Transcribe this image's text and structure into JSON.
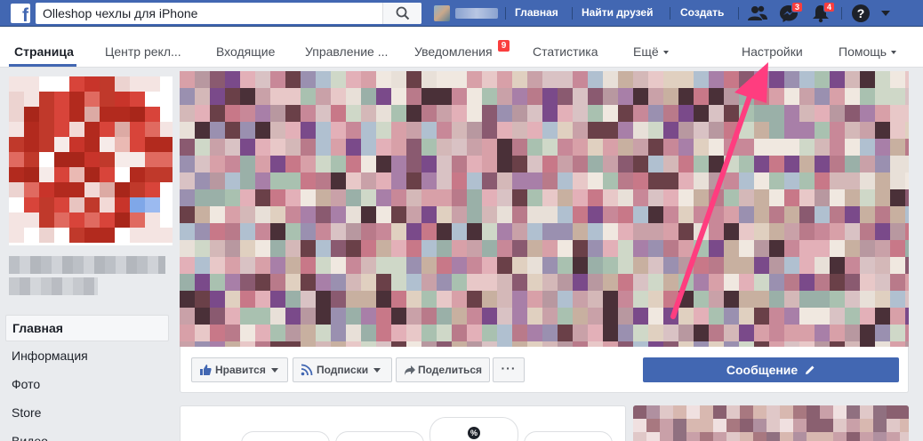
{
  "topbar": {
    "logo": "f",
    "search_value": "Olleshop чехлы для iPhone",
    "links": {
      "home": "Главная",
      "find_friends": "Найти друзей",
      "create": "Создать"
    },
    "badges": {
      "messages": "3",
      "notifications": "4"
    },
    "help": "?",
    "colors": {
      "bar": "#4267b2",
      "badge": "#fa3e3e"
    }
  },
  "pagenav": {
    "items": [
      {
        "label": "Страница"
      },
      {
        "label": "Центр рекл..."
      },
      {
        "label": "Входящие"
      },
      {
        "label": "Управление ..."
      },
      {
        "label": "Уведомления"
      },
      {
        "label": "Статистика"
      },
      {
        "label": "Ещё"
      },
      {
        "label": "Настройки"
      },
      {
        "label": "Помощь"
      }
    ],
    "notifications_badge": "9"
  },
  "left_menu": [
    {
      "label": "Главная"
    },
    {
      "label": "Информация"
    },
    {
      "label": "Фото"
    },
    {
      "label": "Store"
    },
    {
      "label": "Видео"
    }
  ],
  "actions": {
    "like": "Нравится",
    "follow": "Подписки",
    "share": "Поделиться",
    "more": "···",
    "message": "Сообщение"
  },
  "card": {
    "percent_icon": "%"
  },
  "annotation": {
    "arrow_color": "#ff3d7f"
  }
}
